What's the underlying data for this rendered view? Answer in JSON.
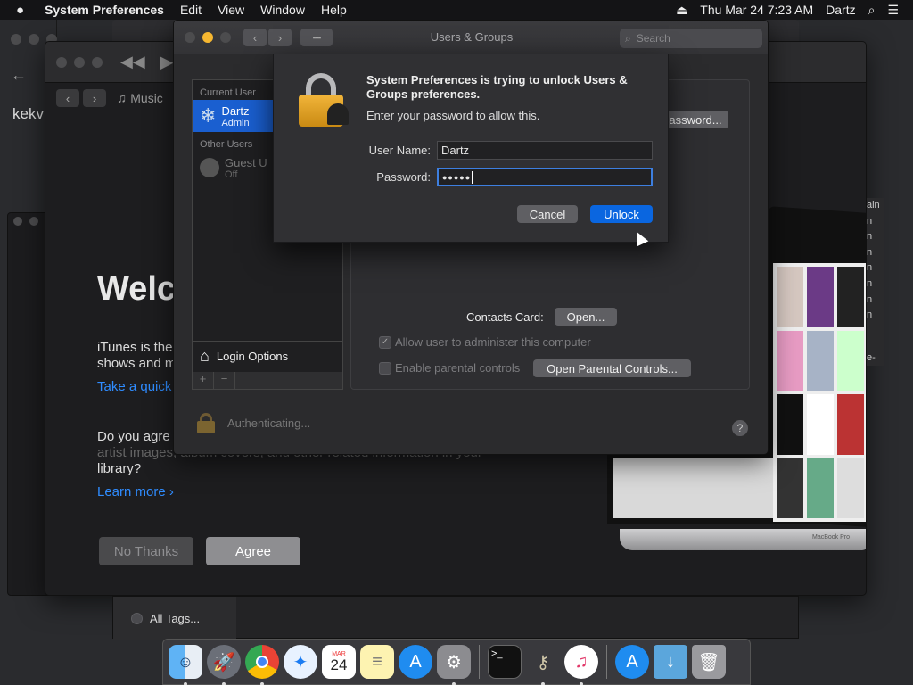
{
  "menubar": {
    "apple": "",
    "app_name": "System Preferences",
    "menus": [
      "Edit",
      "View",
      "Window",
      "Help"
    ],
    "datetime": "Thu Mar 24  7:23 AM",
    "user": "Dartz",
    "icons": [
      "eject-icon",
      "search-icon",
      "menu-list-icon"
    ]
  },
  "background_windows": {
    "left_text": "kekv",
    "all_tags": "All Tags..."
  },
  "itunes": {
    "tab_label": "Music",
    "welcome": "Welco",
    "intro_line1": "iTunes is the",
    "intro_line2": "shows and m",
    "take_a_quick": "Take a quick",
    "agree_line1": "Do you agre",
    "agree_line2": "artist images, album covers, and other related information in your",
    "agree_line3": "library?",
    "learn_more": "Learn more",
    "no_thanks": "No Thanks",
    "agree": "Agree",
    "side_items": [
      "ain",
      "n",
      "n",
      "n",
      "n",
      "n",
      "n",
      "n",
      "e-"
    ],
    "laptop_label": "MacBook Pro"
  },
  "users_groups": {
    "title": "Users & Groups",
    "search_placeholder": "Search",
    "current_user_header": "Current User",
    "current_user_name": "Dartz",
    "current_user_role": "Admin",
    "other_users_header": "Other Users",
    "guest_name": "Guest U",
    "guest_status": "Off",
    "login_options": "Login Options",
    "change_password_partial": "assword...",
    "contacts_card_label": "Contacts Card:",
    "open_button": "Open...",
    "allow_admin": "Allow user to administer this computer",
    "parental_controls": "Enable parental controls",
    "open_parental": "Open Parental Controls...",
    "authenticating": "Authenticating...",
    "help": "?",
    "add": "+",
    "remove": "−"
  },
  "dialog": {
    "title_line1": "System Preferences is trying to unlock Users &",
    "title_line2": "Groups preferences.",
    "message": "Enter your password to allow this.",
    "username_label": "User Name:",
    "username_value": "Dartz",
    "password_label": "Password:",
    "password_value": "●●●●●",
    "cancel": "Cancel",
    "unlock": "Unlock"
  },
  "dock": {
    "items": [
      "finder-icon",
      "launchpad-icon",
      "chrome-icon",
      "safari-icon",
      "calendar-icon",
      "notes-icon",
      "app-store-icon",
      "system-preferences-icon",
      "terminal-icon",
      "keychain-icon",
      "itunes-icon",
      "app-store-folder-icon",
      "downloads-folder-icon",
      "trash-icon"
    ],
    "calendar_day": "24",
    "calendar_month": "MAR"
  },
  "colors": {
    "accent": "#0a66e0",
    "link": "#2f8cff",
    "selection": "#1a5fd0"
  }
}
